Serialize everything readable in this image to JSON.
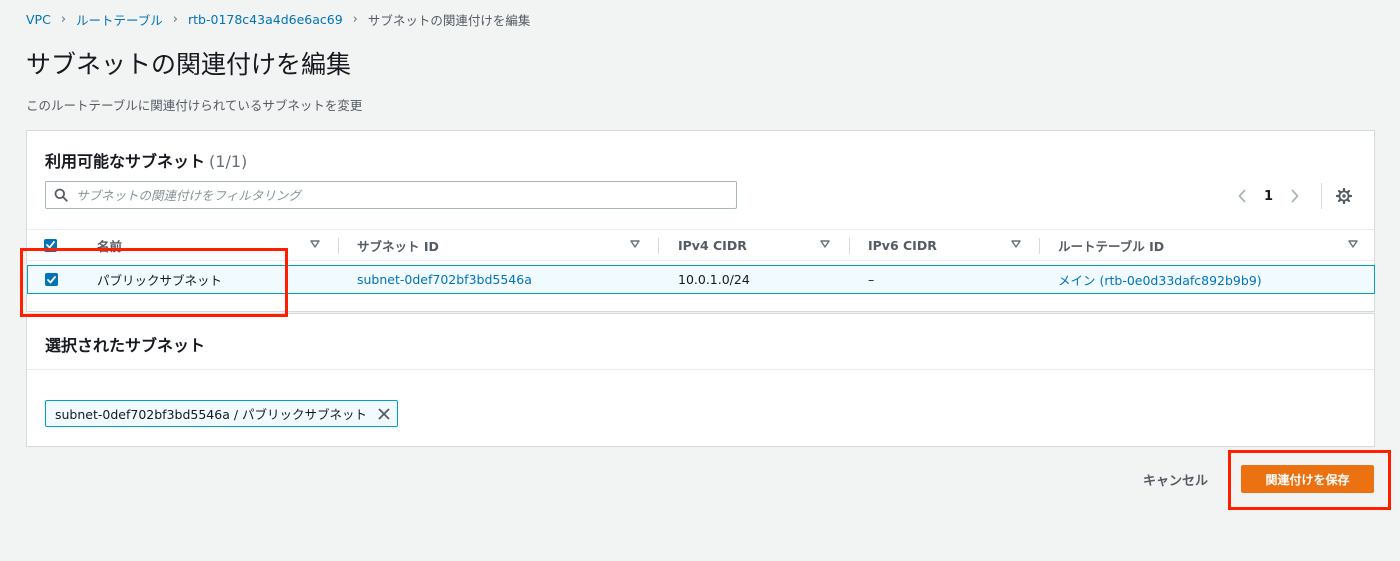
{
  "breadcrumb": {
    "items": [
      "VPC",
      "ルートテーブル",
      "rtb-0178c43a4d6e6ac69"
    ],
    "current": "サブネットの関連付けを編集"
  },
  "page": {
    "title": "サブネットの関連付けを編集",
    "description": "このルートテーブルに関連付けられているサブネットを変更"
  },
  "available_panel": {
    "title": "利用可能なサブネット",
    "count": "(1/1)",
    "search_placeholder": "サブネットの関連付けをフィルタリング",
    "page_number": "1",
    "columns": [
      "名前",
      "サブネット ID",
      "IPv4 CIDR",
      "IPv6 CIDR",
      "ルートテーブル ID"
    ],
    "rows": [
      {
        "name": "パブリックサブネット",
        "subnet_id": "subnet-0def702bf3bd5546a",
        "ipv4_cidr": "10.0.1.0/24",
        "ipv6_cidr": "–",
        "route_table_id": "メイン (rtb-0e0d33dafc892b9b9)",
        "selected": true
      }
    ]
  },
  "selected_panel": {
    "title": "選択されたサブネット",
    "token": "subnet-0def702bf3bd5546a / パブリックサブネット"
  },
  "actions": {
    "cancel": "キャンセル",
    "save": "関連付けを保存"
  },
  "colors": {
    "accent": "#0073bb",
    "primary_button": "#ec7211",
    "highlight": "#ff1e00",
    "selection_border": "#00a1c9"
  }
}
